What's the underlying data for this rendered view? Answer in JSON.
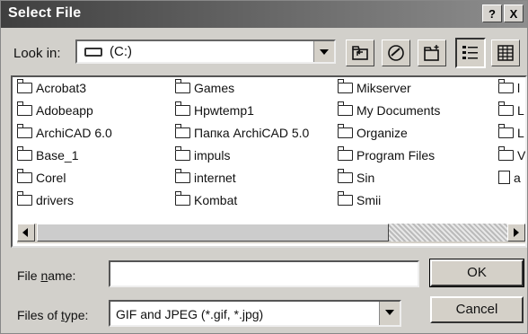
{
  "window": {
    "title": "Select File",
    "help_btn": "?",
    "close_btn": "X"
  },
  "lookin": {
    "label": "Look in:",
    "value": "(C:)"
  },
  "files": [
    {
      "name": "Acrobat3",
      "type": "folder"
    },
    {
      "name": "Adobeapp",
      "type": "folder"
    },
    {
      "name": "ArchiCAD 6.0",
      "type": "folder"
    },
    {
      "name": "Base_1",
      "type": "folder"
    },
    {
      "name": "Corel",
      "type": "folder"
    },
    {
      "name": "drivers",
      "type": "folder"
    },
    {
      "name": "Games",
      "type": "folder"
    },
    {
      "name": "Hpwtemp1",
      "type": "folder"
    },
    {
      "name": "Папка ArchiCAD 5.0",
      "type": "folder"
    },
    {
      "name": "impuls",
      "type": "folder"
    },
    {
      "name": "internet",
      "type": "folder"
    },
    {
      "name": "Kombat",
      "type": "folder"
    },
    {
      "name": "Mikserver",
      "type": "folder"
    },
    {
      "name": "My Documents",
      "type": "folder"
    },
    {
      "name": "Organize",
      "type": "folder"
    },
    {
      "name": "Program Files",
      "type": "folder"
    },
    {
      "name": "Sin",
      "type": "folder"
    },
    {
      "name": "Smii",
      "type": "folder"
    },
    {
      "name": "l",
      "type": "folder"
    },
    {
      "name": "L",
      "type": "folder"
    },
    {
      "name": "L",
      "type": "folder"
    },
    {
      "name": "V",
      "type": "folder"
    },
    {
      "name": "a",
      "type": "file"
    }
  ],
  "filename": {
    "label_pre": "File ",
    "label_u": "n",
    "label_post": "ame:",
    "value": ""
  },
  "filetype": {
    "label_pre": "Files of ",
    "label_u": "t",
    "label_post": "ype:",
    "value": "GIF and JPEG (*.gif, *.jpg)"
  },
  "buttons": {
    "ok": "OK",
    "cancel": "Cancel"
  }
}
